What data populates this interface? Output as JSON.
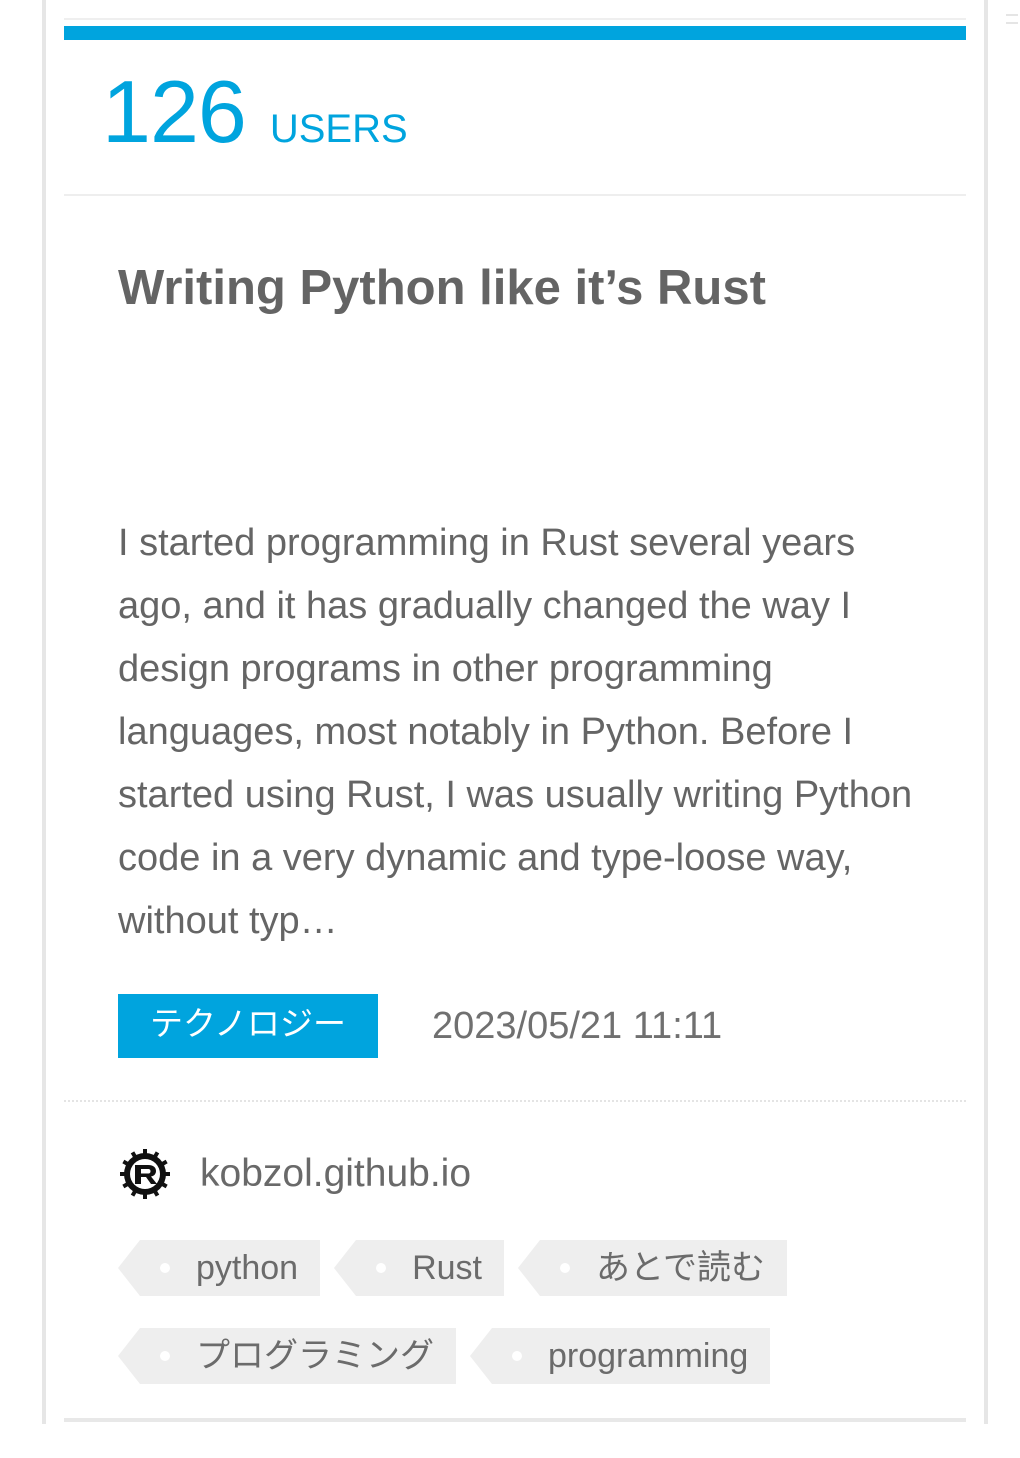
{
  "entry": {
    "users_count": "126",
    "users_label": "USERS",
    "title": "Writing Python like it’s Rust",
    "summary": "I started programming in Rust several years ago, and it has gradually changed the way I design programs in other programming languages, most notably in Python. Before I started using Rust, I was usually writing Python code in a very dynamic and type-loose way, without typ…",
    "category": "テクノロジー",
    "date": "2023/05/21 11:11",
    "domain": "kobzol.github.io",
    "favicon_icon": "rust-logo-icon",
    "tags": [
      {
        "label": "python"
      },
      {
        "label": "Rust"
      },
      {
        "label": "あとで読む"
      },
      {
        "label": "プログラミング"
      },
      {
        "label": "programming"
      }
    ]
  },
  "colors": {
    "accent": "#00a4de",
    "title_text": "#646464",
    "body_text": "#656565",
    "tag_bg": "#eeeeee"
  }
}
